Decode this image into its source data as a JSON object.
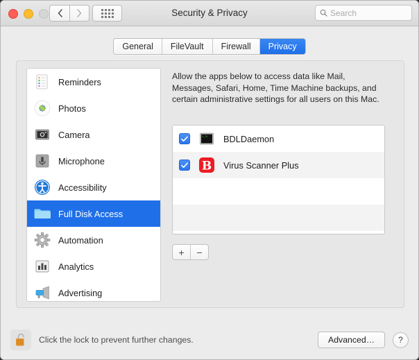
{
  "window": {
    "title": "Security & Privacy",
    "traffic_lights": [
      "close",
      "minimize",
      "zoom"
    ],
    "nav": {
      "back": "‹",
      "forward": "›"
    },
    "grid_button": "show-all-preferences"
  },
  "search": {
    "placeholder": "Search",
    "value": "",
    "icon": "search-icon"
  },
  "tabs": [
    {
      "label": "General",
      "active": false
    },
    {
      "label": "FileVault",
      "active": false
    },
    {
      "label": "Firewall",
      "active": false
    },
    {
      "label": "Privacy",
      "active": true
    }
  ],
  "sidebar": {
    "items": [
      {
        "label": "Reminders",
        "icon": "reminders-icon",
        "selected": false
      },
      {
        "label": "Photos",
        "icon": "photos-icon",
        "selected": false
      },
      {
        "label": "Camera",
        "icon": "camera-icon",
        "selected": false
      },
      {
        "label": "Microphone",
        "icon": "microphone-icon",
        "selected": false
      },
      {
        "label": "Accessibility",
        "icon": "accessibility-icon",
        "selected": false
      },
      {
        "label": "Full Disk Access",
        "icon": "folder-icon",
        "selected": true
      },
      {
        "label": "Automation",
        "icon": "gear-icon",
        "selected": false
      },
      {
        "label": "Analytics",
        "icon": "bar-chart-icon",
        "selected": false
      },
      {
        "label": "Advertising",
        "icon": "megaphone-icon",
        "selected": false
      }
    ]
  },
  "main": {
    "description": "Allow the apps below to access data like Mail, Messages, Safari, Home, Time Machine backups, and certain administrative settings for all users on this Mac.",
    "apps": [
      {
        "name": "BDLDaemon",
        "checked": true,
        "icon": "terminal-icon"
      },
      {
        "name": "Virus Scanner Plus",
        "checked": true,
        "icon": "bitdefender-b-icon"
      }
    ],
    "add_button": "+",
    "remove_button": "−"
  },
  "footer": {
    "lock_icon": "unlocked-padlock-icon",
    "lock_text": "Click the lock to prevent further changes.",
    "advanced_label": "Advanced…",
    "help_label": "?"
  },
  "colors": {
    "accent": "#1f6fe8",
    "window_bg": "#ececec",
    "panel_bg": "#e7e7e7",
    "checkbox": "#2b77ec",
    "virus_scanner_red": "#ed1c24",
    "folder_blue": "#7fd0f5"
  }
}
